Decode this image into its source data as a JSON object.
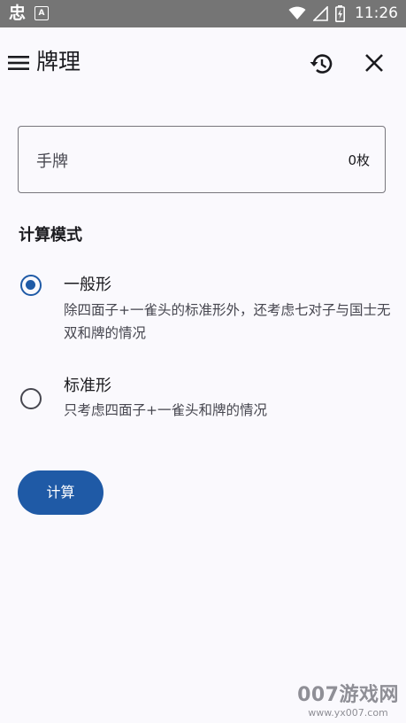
{
  "status_bar": {
    "app_glyph": "忠",
    "a_icon": "A",
    "time": "11:26",
    "icons": [
      "wifi-icon",
      "signal-icon",
      "battery-charging-icon"
    ]
  },
  "app_bar": {
    "title": "牌理",
    "icons": [
      "menu-icon",
      "history-icon",
      "close-icon"
    ]
  },
  "hand_input": {
    "label": "手牌",
    "count": "0枚"
  },
  "mode_section": {
    "title": "计算模式",
    "selected": "general",
    "options": [
      {
        "id": "general",
        "label": "一般形",
        "description": "除四面子+一雀头的标准形外，还考虑七对子与国士无双和牌的情况"
      },
      {
        "id": "standard",
        "label": "标准形",
        "description": "只考虑四面子+一雀头和牌的情况"
      }
    ]
  },
  "calculate_button": {
    "label": "计算"
  },
  "watermark": {
    "text": "007游戏网",
    "url": "www.yx007.com"
  },
  "colors": {
    "accent": "#1f5aa6",
    "status_bar": "#757575",
    "background": "#faf9fd"
  }
}
